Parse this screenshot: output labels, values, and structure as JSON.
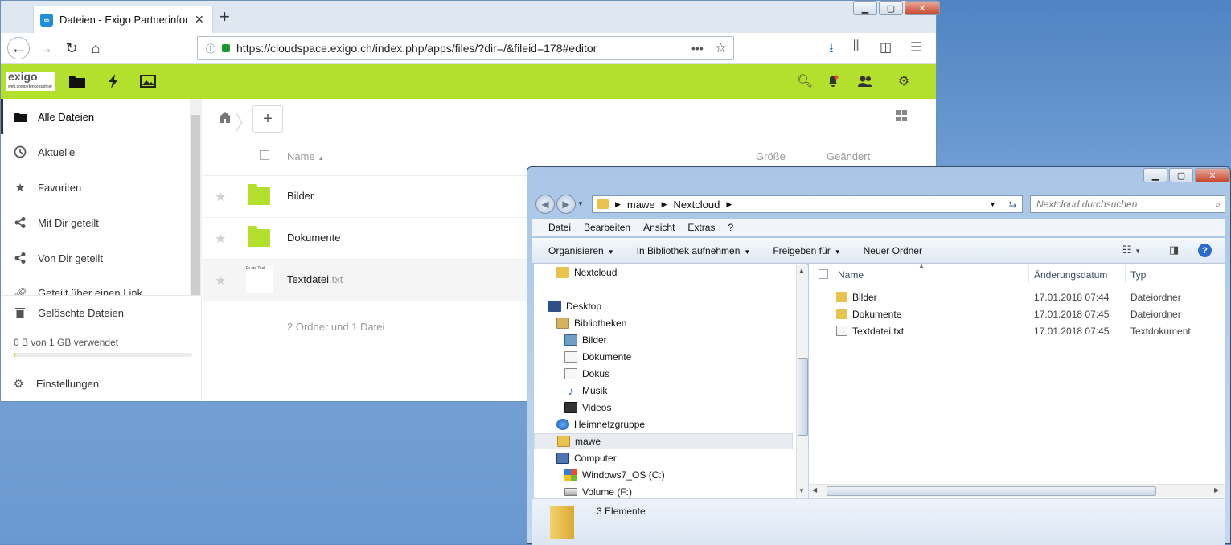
{
  "browser": {
    "tab_title": "Dateien - Exigo Partnerinformat",
    "url": "https://cloudspace.exigo.ch/index.php/apps/files/?dir=/&fileid=178#editor",
    "new_tab_label": "+"
  },
  "nextcloud": {
    "logo_text": "exigo",
    "logo_sub": "web.competence partner",
    "sidebar": {
      "items": [
        {
          "label": "Alle Dateien"
        },
        {
          "label": "Aktuelle"
        },
        {
          "label": "Favoriten"
        },
        {
          "label": "Mit Dir geteilt"
        },
        {
          "label": "Von Dir geteilt"
        },
        {
          "label": "Geteilt über einen Link"
        }
      ],
      "trash_label": "Gelöschte Dateien",
      "quota_text": "0 B von 1 GB verwendet",
      "quota_fraction": 0.0,
      "settings_label": "Einstellungen"
    },
    "table": {
      "col_name": "Name",
      "col_size": "Größe",
      "col_modified": "Geändert",
      "rows": [
        {
          "name": "Bilder",
          "ext": ""
        },
        {
          "name": "Dokumente",
          "ext": ""
        },
        {
          "name": "Textdatei",
          "ext": ".txt",
          "thumb_text": "Er ste Text"
        }
      ],
      "summary": "2 Ordner und 1 Datei"
    }
  },
  "explorer": {
    "address": {
      "crumbs": [
        "mawe",
        "Nextcloud"
      ]
    },
    "search_placeholder": "Nextcloud durchsuchen",
    "menu": [
      "Datei",
      "Bearbeiten",
      "Ansicht",
      "Extras",
      "?"
    ],
    "commands": [
      "Organisieren",
      "In Bibliothek aufnehmen",
      "Freigeben für",
      "Neuer Ordner"
    ],
    "tree": [
      {
        "label": "Nextcloud"
      },
      {
        "label": "Desktop"
      },
      {
        "label": "Bibliotheken"
      },
      {
        "label": "Bilder"
      },
      {
        "label": "Dokumente"
      },
      {
        "label": "Dokus"
      },
      {
        "label": "Musik"
      },
      {
        "label": "Videos"
      },
      {
        "label": "Heimnetzgruppe"
      },
      {
        "label": "mawe"
      },
      {
        "label": "Computer"
      },
      {
        "label": "Windows7_OS (C:)"
      },
      {
        "label": "Volume (F:)"
      }
    ],
    "list_headers": {
      "name": "Name",
      "date": "Änderungsdatum",
      "type": "Typ"
    },
    "files": [
      {
        "name": "Bilder",
        "date": "17.01.2018 07:44",
        "type": "Dateiordner"
      },
      {
        "name": "Dokumente",
        "date": "17.01.2018 07:45",
        "type": "Dateiordner"
      },
      {
        "name": "Textdatei.txt",
        "date": "17.01.2018 07:45",
        "type": "Textdokument"
      }
    ],
    "details_text": "3 Elemente"
  }
}
